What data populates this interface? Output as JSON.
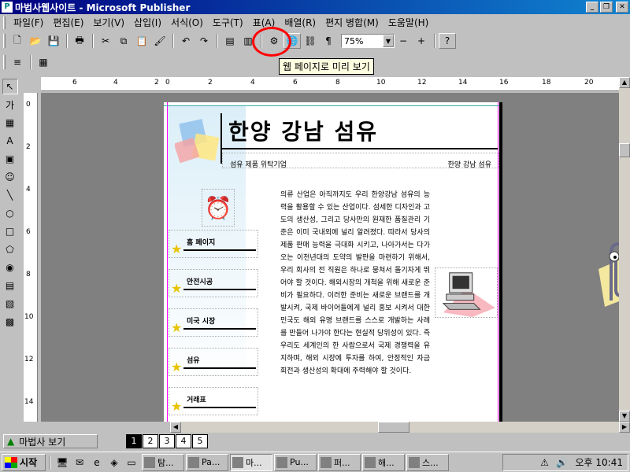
{
  "window": {
    "title": "마법사웹사이트 - Microsoft Publisher",
    "app_icon": "publisher-icon",
    "minimize": "_",
    "restore": "❐",
    "close": "✕"
  },
  "menu": {
    "items": [
      {
        "label": "파일(F)"
      },
      {
        "label": "편집(E)"
      },
      {
        "label": "보기(V)"
      },
      {
        "label": "삽입(I)"
      },
      {
        "label": "서식(O)"
      },
      {
        "label": "도구(T)"
      },
      {
        "label": "표(A)"
      },
      {
        "label": "배열(R)"
      },
      {
        "label": "편지 병합(M)"
      },
      {
        "label": "도움말(H)"
      }
    ]
  },
  "toolbar": {
    "zoom_value": "75%",
    "tooltip": "웹 페이지로 미리 보기",
    "zoom_minus": "−",
    "zoom_plus": "+"
  },
  "document": {
    "site_title": "한양 강남 섬유",
    "subtitle_left": "섬유 제품 위탁기업",
    "subtitle_right": "한양 강남 섬유",
    "nav": [
      {
        "label": "홈 페이지"
      },
      {
        "label": "안전시공"
      },
      {
        "label": "미국 시장"
      },
      {
        "label": "섬유"
      },
      {
        "label": "거래표"
      }
    ],
    "body_text": "의류 산업은 아직까지도 우리 한양강남 섬유의 능력을 활용할 수 있는 산업이다. 섬세한 디자인과 고도의 생산성, 그리고 당사만의 원재한 품질관리 기준은 이미 국내외에 널리 알려졌다. 따라서 당사의 제품 판매 능력을 극대화 시키고, 나아가서는 다가오는 이천년대의 도약의 발판을 마련하기 위해서, 우리 회사의 전 직원은 하나로 뭉쳐서 돌기자게 뛰어야 할 것이다. 해외시장의 개척을 위해 새로운 준비가 필요하다. 이러한 준비는 새로운 브랜드를 개발시켜, 국제 바이어들에게 널리 홍보 시켜서 대한민국도 해외 유명 브랜드를 스스로 개발하는 사례를 만들어 나가야 한다는 현실적 당위성이 있다. 즉 우리도 세계인의 한 사람으로서 국제 경쟁력을 유지하며, 해외 시장에 투자를 하여, 안정적인 자금 회전과 생산성의 확대에 주력해야 할 것이다."
  },
  "rulers": {
    "h_labels": [
      "6",
      "4",
      "2",
      "0",
      "2",
      "4",
      "6",
      "8",
      "10",
      "12",
      "14",
      "16",
      "18",
      "20"
    ],
    "v_labels": [
      "0",
      "2",
      "4",
      "6",
      "8",
      "10",
      "12",
      "14"
    ]
  },
  "statusbar": {
    "wizard_label": "마법사 보기",
    "pages": [
      "1",
      "2",
      "3",
      "4",
      "5"
    ],
    "active_page": "1"
  },
  "taskbar": {
    "start_label": "시작",
    "tasks": [
      {
        "label": "탐..."
      },
      {
        "label": "Pa..."
      },
      {
        "label": "마..."
      },
      {
        "label": "Pu..."
      },
      {
        "label": "퍼..."
      },
      {
        "label": "해..."
      },
      {
        "label": "스..."
      }
    ],
    "clock": "오후 10:41"
  }
}
